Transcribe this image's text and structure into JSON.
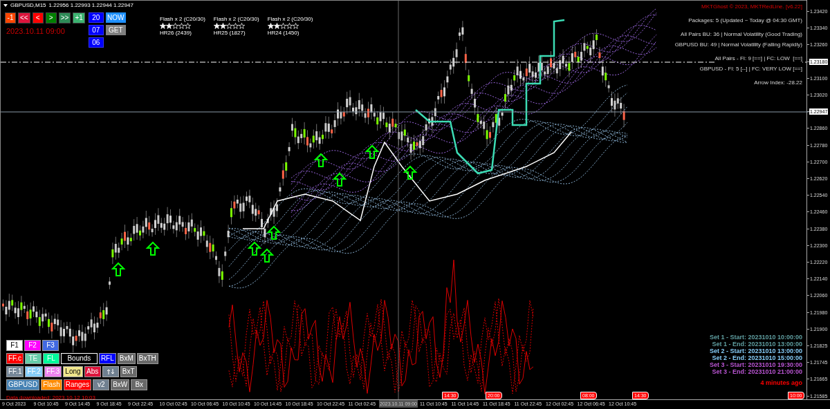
{
  "chart_window": {
    "title": "GBPUSD,M15",
    "ohlc": "1.22956 1.22993 1.22944 1.22947"
  },
  "nav_buttons": [
    {
      "label": "-1",
      "color": "#ff4500"
    },
    {
      "label": "<<",
      "color": "#dc143c"
    },
    {
      "label": "<",
      "color": "#ff0000"
    },
    {
      "label": ">",
      "color": "#008000"
    },
    {
      "label": ">>",
      "color": "#2e8b57"
    },
    {
      "label": "+1",
      "color": "#3cb371"
    }
  ],
  "date_display": "2023.10.11 09:00",
  "time_buttons": [
    "20",
    "07",
    "06"
  ],
  "now_button": "NOW",
  "get_button": "GET",
  "flash_signals": [
    {
      "title": "Flash x 2 (C20/30)",
      "stars": 2,
      "label": "HR26 (2439)"
    },
    {
      "title": "Flash x 2 (C20/30)",
      "stars": 2,
      "label": "HR25 (1827)"
    },
    {
      "title": "Flash x 2 (C20/30)",
      "stars": 2,
      "label": "HR24 (1450)"
    }
  ],
  "info_panel": {
    "copyright": "MKTGhost © 2023, MKTRedLine. [v6.22]",
    "groups": [
      [
        "Packages: 5 (Updated ~ Today @ 04:30 GMT)"
      ],
      [
        "All Pairs BU: 36 | Normal Volatility (Good Trading)",
        "GBPUSD BU: 49 | Normal Volatility (Falling Rapidly)"
      ],
      [
        "All Pairs - FI: 9 [==] | FC: LOW  [==]",
        "GBPUSD - FI: 5 [--] | FC: VERY LOW [==]"
      ],
      [
        "Arrow Index: -28.22"
      ]
    ]
  },
  "sets": [
    {
      "text": "Set 1 - Start: 20231010 10:00:00",
      "color": "#5f9ea0"
    },
    {
      "text": "Set 1 - End: 20231010 13:00:00",
      "color": "#5f9ea0"
    },
    {
      "text": "Set 2 - Start: 20231010 13:00:00",
      "color": "#87cefa"
    },
    {
      "text": "Set 2 - End: 20231010 15:00:00",
      "color": "#87cefa"
    },
    {
      "text": "Set 3 - Start: 20231010 19:30:00",
      "color": "#ba55d3"
    },
    {
      "text": "Set 3 - End: 20231010 21:00:00",
      "color": "#ba55d3"
    }
  ],
  "age": "4 minutes ago",
  "download_status": "Data downloaded: 2023.10.12 10:03",
  "control_rows": [
    [
      {
        "kind": "fill",
        "label": "F1",
        "color": "#ffffff"
      },
      {
        "kind": "fill",
        "label": "F2",
        "color": "#ff00ff"
      },
      {
        "kind": "fill",
        "label": "F3",
        "color": "#4169e1"
      }
    ],
    [
      {
        "kind": "fill",
        "label": "FF.c",
        "color": "#ff0000"
      },
      {
        "kind": "fill",
        "label": "TE",
        "color": "#66cdaa"
      },
      {
        "kind": "fill",
        "label": "FL",
        "color": "#00fa9a"
      },
      {
        "kind": "outline",
        "label": "Bounds",
        "color": "#000000"
      },
      {
        "kind": "fill",
        "label": "RFL",
        "color": "#0000ff"
      },
      {
        "kind": "fill",
        "label": "BxM",
        "color": "#696969"
      },
      {
        "kind": "fill",
        "label": "BxTH",
        "color": "#696969"
      }
    ],
    [
      {
        "kind": "fill",
        "label": "FF.1",
        "color": "#778899"
      },
      {
        "kind": "fill",
        "label": "FF.2",
        "color": "#87cefa"
      },
      {
        "kind": "fill",
        "label": "FF.3",
        "color": "#ee82ee"
      },
      {
        "kind": "fill",
        "label": "Long",
        "color": "#f0e68c"
      },
      {
        "kind": "fill",
        "label": "Abs",
        "color": "#dc143c"
      },
      {
        "kind": "icon",
        "color": "#708090"
      },
      {
        "kind": "fill",
        "label": "BxT",
        "color": "#696969"
      }
    ],
    [
      {
        "kind": "fill",
        "label": "GBPUSD",
        "color": "#4682b4"
      },
      {
        "kind": "fill",
        "label": "Flash",
        "color": "#ff8c00"
      },
      {
        "kind": "fill",
        "label": "Ranges",
        "color": "#ff0000"
      },
      {
        "kind": "fill",
        "label": "v2",
        "color": "#708090"
      },
      {
        "kind": "fill",
        "label": "BxW",
        "color": "#696969"
      },
      {
        "kind": "fill",
        "label": "Bx",
        "color": "#696969"
      }
    ]
  ],
  "event_flags": [
    "14:30",
    "20:00",
    "08:00",
    "14:30",
    "10:00"
  ],
  "price_axis": [
    {
      "label": "1.23420",
      "highlight": false
    },
    {
      "label": "1.23340",
      "highlight": false
    },
    {
      "label": "1.23260",
      "highlight": false
    },
    {
      "label": "1.23180",
      "highlight": true
    },
    {
      "label": "1.23100",
      "highlight": false
    },
    {
      "label": "1.23020",
      "highlight": false
    },
    {
      "label": "1.22947",
      "highlight": true
    },
    {
      "label": "1.22860",
      "highlight": false
    },
    {
      "label": "1.22780",
      "highlight": false
    },
    {
      "label": "1.22700",
      "highlight": false
    },
    {
      "label": "1.22620",
      "highlight": false
    },
    {
      "label": "1.22540",
      "highlight": false
    },
    {
      "label": "1.22460",
      "highlight": false
    },
    {
      "label": "1.22380",
      "highlight": false
    },
    {
      "label": "1.22300",
      "highlight": false
    },
    {
      "label": "1.22220",
      "highlight": false
    },
    {
      "label": "1.22140",
      "highlight": false
    },
    {
      "label": "1.22060",
      "highlight": false
    },
    {
      "label": "1.21980",
      "highlight": false
    },
    {
      "label": "1.21900",
      "highlight": false
    },
    {
      "label": "1.21825",
      "highlight": false
    },
    {
      "label": "1.21745",
      "highlight": false
    },
    {
      "label": "1.21665",
      "highlight": false
    },
    {
      "label": "1.21585",
      "highlight": false
    }
  ],
  "time_axis": [
    {
      "label": "9 Oct 2023",
      "highlight": false
    },
    {
      "label": "9 Oct 10:45",
      "highlight": false
    },
    {
      "label": "9 Oct 14:45",
      "highlight": false
    },
    {
      "label": "9 Oct 18:45",
      "highlight": false
    },
    {
      "label": "9 Oct 22:45",
      "highlight": false
    },
    {
      "label": "10 Oct 02:45",
      "highlight": false
    },
    {
      "label": "10 Oct 06:45",
      "highlight": false
    },
    {
      "label": "10 Oct 10:45",
      "highlight": false
    },
    {
      "label": "10 Oct 14:45",
      "highlight": false
    },
    {
      "label": "10 Oct 18:45",
      "highlight": false
    },
    {
      "label": "10 Oct 22:45",
      "highlight": false
    },
    {
      "label": "11 Oct 02:45",
      "highlight": false
    },
    {
      "label": "2023.10.11 09:00",
      "highlight": true
    },
    {
      "label": "11 Oct 10:45",
      "highlight": false
    },
    {
      "label": "11 Oct 14:45",
      "highlight": false
    },
    {
      "label": "11 Oct 18:45",
      "highlight": false
    },
    {
      "label": "11 Oct 22:45",
      "highlight": false
    },
    {
      "label": "12 Oct 02:45",
      "highlight": false
    },
    {
      "label": "12 Oct 06:45",
      "highlight": false
    },
    {
      "label": "12 Oct 10:45",
      "highlight": false
    }
  ]
}
